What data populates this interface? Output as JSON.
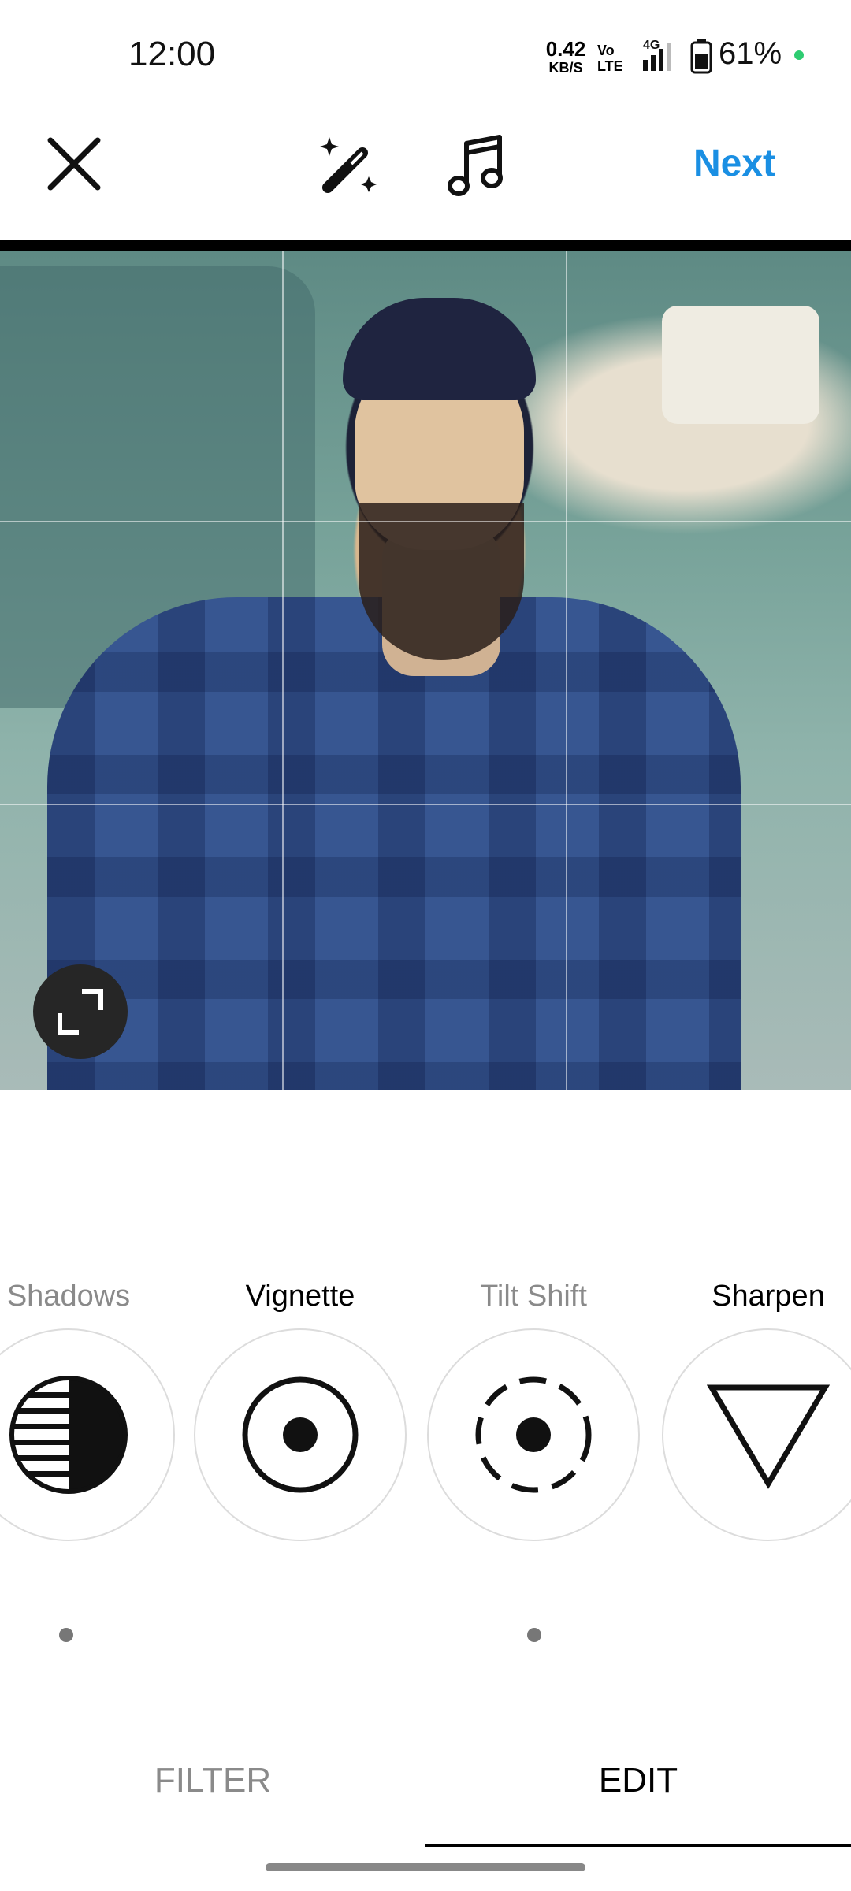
{
  "status_bar": {
    "time": "12:00",
    "network_speed_value": "0.42",
    "network_speed_unit": "KB/S",
    "volte_label_top": "Vo",
    "volte_label_bottom": "LTE",
    "network_type": "4G",
    "battery_percent": "61%",
    "icons": [
      "signal-icon",
      "battery-icon",
      "green-dot-indicator"
    ]
  },
  "toolbar": {
    "close_icon": "close-icon",
    "magic_icon": "magic-wand-icon",
    "music_icon": "music-note-icon",
    "next_label": "Next"
  },
  "photo": {
    "expand_icon": "expand-icon",
    "grid": "3x3"
  },
  "tools": [
    {
      "label": "Shadows",
      "icon": "shadows-icon",
      "dimmed": true
    },
    {
      "label": "Vignette",
      "icon": "vignette-icon",
      "dimmed": false
    },
    {
      "label": "Tilt Shift",
      "icon": "tilt-shift-icon",
      "dimmed": true
    },
    {
      "label": "Sharpen",
      "icon": "sharpen-icon",
      "dimmed": false
    }
  ],
  "tabs": {
    "filter": "FILTER",
    "edit": "EDIT",
    "active": "EDIT"
  },
  "colors": {
    "accent": "#1a8fe3",
    "muted_text": "#8a8a8a",
    "status_dot": "#2ecc71"
  }
}
